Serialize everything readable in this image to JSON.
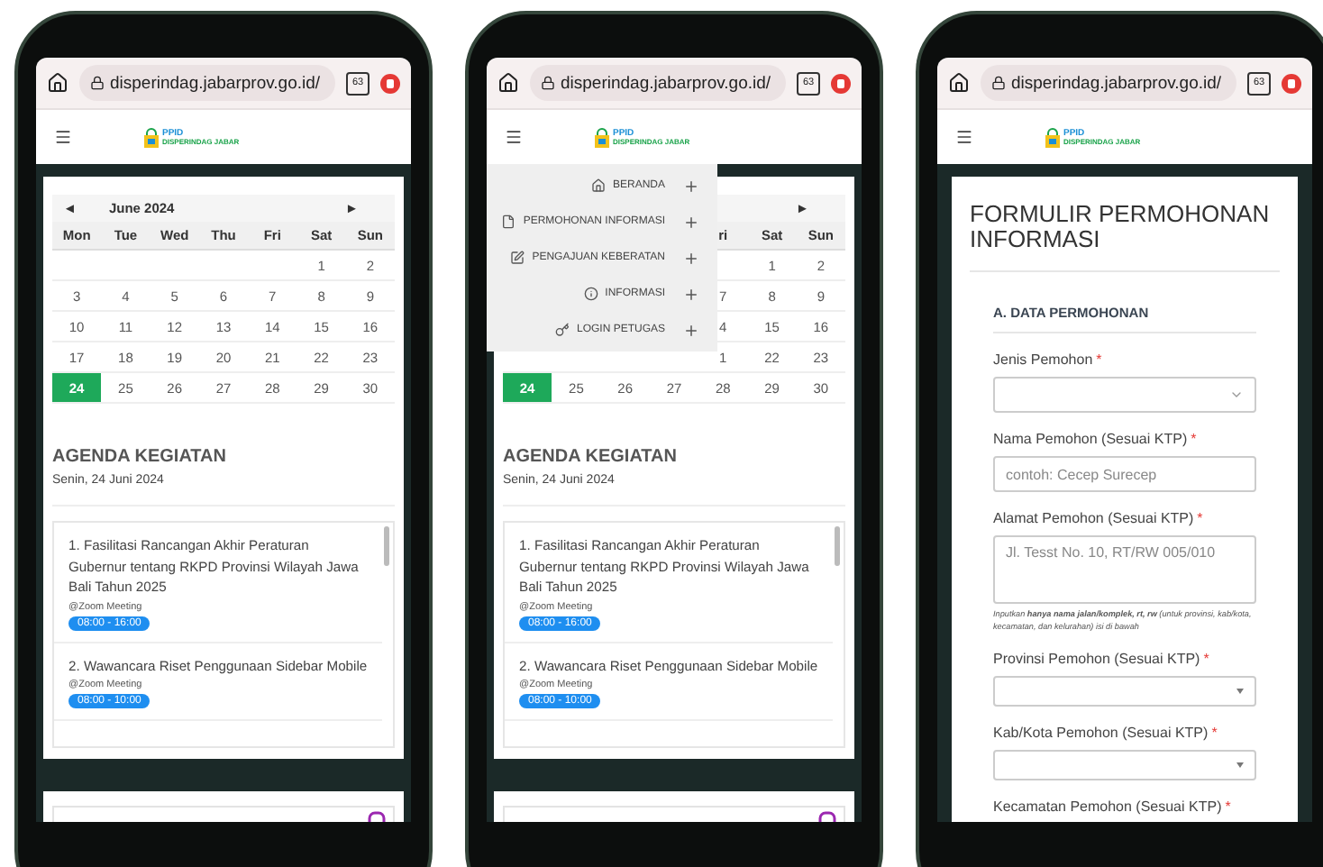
{
  "phones": [
    {
      "kind": "agenda",
      "browser": {
        "url": "disperindag.jabarprov.go.id/",
        "tabs": "63"
      },
      "logo": {
        "title": "PPID",
        "subtitle": "DISPERINDAG JABAR"
      },
      "calendar": {
        "prev": "◄",
        "month": "June 2024",
        "next": "►",
        "weekdays": [
          {
            "kind": "label",
            "label": "Mon"
          },
          {
            "kind": "label",
            "label": "Tue"
          },
          {
            "kind": "label",
            "label": "Wed"
          },
          {
            "kind": "label",
            "label": "Thu"
          },
          {
            "kind": "label",
            "label": "Fri"
          },
          {
            "kind": "label",
            "label": "Sat"
          },
          {
            "kind": "label",
            "label": "Sun"
          }
        ],
        "weeks": [
          [
            {
              "kind": "blank"
            },
            {
              "kind": "blank"
            },
            {
              "kind": "blank"
            },
            {
              "kind": "blank"
            },
            {
              "kind": "blank"
            },
            {
              "day": "1",
              "selected": false
            },
            {
              "day": "2",
              "selected": false
            }
          ],
          [
            {
              "day": "3",
              "selected": false
            },
            {
              "day": "4",
              "selected": false
            },
            {
              "day": "5",
              "selected": false
            },
            {
              "day": "6",
              "selected": false
            },
            {
              "day": "7",
              "selected": false
            },
            {
              "day": "8",
              "selected": false
            },
            {
              "day": "9",
              "selected": false
            }
          ],
          [
            {
              "day": "10",
              "selected": false
            },
            {
              "day": "11",
              "selected": false
            },
            {
              "day": "12",
              "selected": false
            },
            {
              "day": "13",
              "selected": false
            },
            {
              "day": "14",
              "selected": false
            },
            {
              "day": "15",
              "selected": false
            },
            {
              "day": "16",
              "selected": false
            }
          ],
          [
            {
              "day": "17",
              "selected": false
            },
            {
              "day": "18",
              "selected": false
            },
            {
              "day": "19",
              "selected": false
            },
            {
              "day": "20",
              "selected": false
            },
            {
              "day": "21",
              "selected": false
            },
            {
              "day": "22",
              "selected": false
            },
            {
              "day": "23",
              "selected": false
            }
          ],
          [
            {
              "day": "24",
              "selected": true
            },
            {
              "day": "25",
              "selected": false
            },
            {
              "day": "26",
              "selected": false
            },
            {
              "day": "27",
              "selected": false
            },
            {
              "day": "28",
              "selected": false
            },
            {
              "day": "29",
              "selected": false
            },
            {
              "day": "30",
              "selected": false
            }
          ]
        ]
      },
      "agenda": {
        "title": "AGENDA KEGIATAN",
        "date": "Senin, 24 Juni 2024",
        "items": [
          {
            "title": "1. Fasilitasi Rancangan Akhir Peraturan Gubernur tentang RKPD Provinsi Wilayah Jawa Bali Tahun 2025",
            "place": "@Zoom Meeting",
            "time": "08:00 - 16:00"
          },
          {
            "title": "2. Wawancara Riset Penggunaan Sidebar Mobile",
            "place": "@Zoom Meeting",
            "time": "08:00 - 10:00"
          }
        ]
      }
    },
    {
      "kind": "agenda",
      "browser": {
        "url": "disperindag.jabarprov.go.id/",
        "tabs": "63"
      },
      "logo": {
        "title": "PPID",
        "subtitle": "DISPERINDAG JABAR"
      },
      "menu": [
        {
          "kind": "home",
          "label": "BERANDA"
        },
        {
          "kind": "file",
          "label": "PERMOHONAN INFORMASI"
        },
        {
          "kind": "edit",
          "label": "PENGAJUAN KEBERATAN"
        },
        {
          "kind": "info",
          "label": "INFORMASI"
        },
        {
          "kind": "key",
          "label": "LOGIN PETUGAS"
        }
      ],
      "calendar": {
        "next": "►",
        "weekdays": [
          {
            "kind": "blank"
          },
          {
            "kind": "blank"
          },
          {
            "kind": "blank"
          },
          {
            "kind": "blank"
          },
          {
            "kind": "label",
            "label": "ri"
          },
          {
            "kind": "label",
            "label": "Sat"
          },
          {
            "kind": "label",
            "label": "Sun"
          }
        ],
        "weeks": [
          [
            {
              "kind": "blank"
            },
            {
              "kind": "blank"
            },
            {
              "kind": "blank"
            },
            {
              "kind": "blank"
            },
            {
              "kind": "blank"
            },
            {
              "day": "1",
              "selected": false
            },
            {
              "day": "2",
              "selected": false
            }
          ],
          [
            {
              "kind": "blank"
            },
            {
              "kind": "blank"
            },
            {
              "kind": "blank"
            },
            {
              "kind": "blank"
            },
            {
              "day": "7",
              "selected": false
            },
            {
              "day": "8",
              "selected": false
            },
            {
              "day": "9",
              "selected": false
            }
          ],
          [
            {
              "kind": "blank"
            },
            {
              "kind": "blank"
            },
            {
              "kind": "blank"
            },
            {
              "kind": "blank"
            },
            {
              "day": "4",
              "selected": false
            },
            {
              "day": "15",
              "selected": false
            },
            {
              "day": "16",
              "selected": false
            }
          ],
          [
            {
              "kind": "blank"
            },
            {
              "kind": "blank"
            },
            {
              "kind": "blank"
            },
            {
              "kind": "blank"
            },
            {
              "day": "1",
              "selected": false
            },
            {
              "day": "22",
              "selected": false
            },
            {
              "day": "23",
              "selected": false
            }
          ],
          [
            {
              "day": "24",
              "selected": true
            },
            {
              "day": "25",
              "selected": false
            },
            {
              "day": "26",
              "selected": false
            },
            {
              "day": "27",
              "selected": false
            },
            {
              "day": "28",
              "selected": false
            },
            {
              "day": "29",
              "selected": false
            },
            {
              "day": "30",
              "selected": false
            }
          ]
        ]
      },
      "agenda": {
        "title": "AGENDA KEGIATAN",
        "date": "Senin, 24 Juni 2024",
        "items": [
          {
            "title": "1. Fasilitasi Rancangan Akhir Peraturan Gubernur tentang RKPD Provinsi Wilayah Jawa Bali Tahun 2025",
            "place": "@Zoom Meeting",
            "time": "08:00 - 16:00"
          },
          {
            "title": "2. Wawancara Riset Penggunaan Sidebar Mobile",
            "place": "@Zoom Meeting",
            "time": "08:00 - 10:00"
          }
        ]
      }
    },
    {
      "kind": "form",
      "browser": {
        "url": "disperindag.jabarprov.go.id/",
        "tabs": "63"
      },
      "logo": {
        "title": "PPID",
        "subtitle": "DISPERINDAG JABAR"
      },
      "form": {
        "title": "FORMULIR PERMOHONAN INFORMASI",
        "section": "A. DATA PERMOHONAN",
        "fields": [
          {
            "kind": "select",
            "label": "Jenis Pemohon",
            "mark": "*"
          },
          {
            "kind": "text",
            "label": "Nama Pemohon (Sesuai KTP)",
            "mark": "*",
            "placeholder": "contoh: Cecep Surecep"
          },
          {
            "kind": "textarea",
            "label": "Alamat Pemohon (Sesuai KTP)",
            "mark": "*",
            "placeholder": "Jl. Tesst No. 10, RT/RW 005/010",
            "help": "Inputkan **hanya nama jalan/komplek, rt, rw** (untuk provinsi, kab/kota, kecamatan, dan kelurahan) isi di bawah"
          },
          {
            "kind": "dropdown",
            "label": "Provinsi Pemohon (Sesuai KTP)",
            "mark": "*"
          },
          {
            "kind": "dropdown",
            "label": "Kab/Kota Pemohon (Sesuai KTP)",
            "mark": "*"
          },
          {
            "kind": "label",
            "label": "Kecamatan Pemohon (Sesuai KTP)",
            "mark": "*"
          }
        ]
      }
    }
  ]
}
